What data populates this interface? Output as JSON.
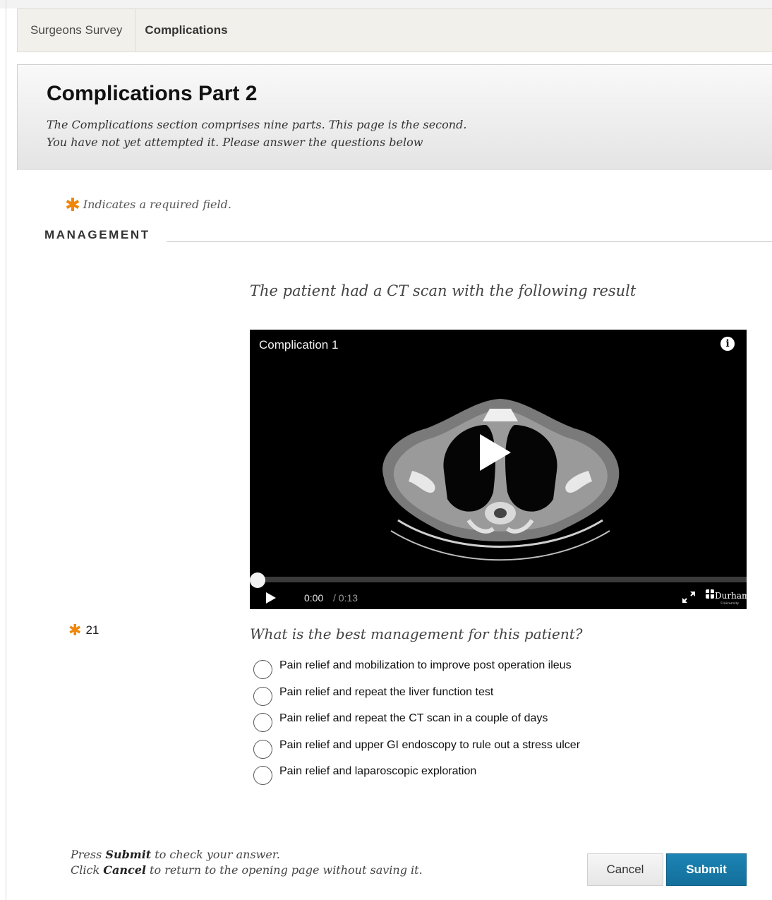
{
  "breadcrumb": {
    "items": [
      {
        "label": "Surgeons Survey"
      },
      {
        "label": "Complications"
      }
    ]
  },
  "header": {
    "title": "Complications Part 2",
    "intro_line1": "The Complications section comprises nine parts. This page is the second.",
    "intro_line2": "You have not yet attempted it. Please answer the questions below"
  },
  "required_note": "Indicates a required field.",
  "section": {
    "heading": "MANAGEMENT"
  },
  "prompt": "The patient had a CT scan with the following result",
  "video": {
    "title": "Complication 1",
    "current_time": "0:00",
    "total_time": "/ 0:13",
    "progress": 0,
    "logo_text": "Durham",
    "logo_subtext": "University"
  },
  "question": {
    "number": "21",
    "text": "What is the best management for this patient?",
    "options": [
      {
        "label": "Pain relief and mobilization to improve post operation ileus"
      },
      {
        "label": "Pain relief and repeat the liver function test"
      },
      {
        "label": "Pain relief and repeat the CT scan in a couple of days"
      },
      {
        "label": "Pain relief and upper GI endoscopy to rule out a stress ulcer"
      },
      {
        "label": "Pain relief and laparoscopic exploration"
      }
    ]
  },
  "footer": {
    "line1_pre": "Press ",
    "line1_bold": "Submit",
    "line1_post": " to check your answer.",
    "line2_pre": "Click ",
    "line2_bold": "Cancel",
    "line2_post": " to return to the opening page without saving it."
  },
  "buttons": {
    "cancel": "Cancel",
    "submit": "Submit"
  },
  "colors": {
    "accent_required": "#f0860a",
    "submit_button": "#1779a8"
  }
}
